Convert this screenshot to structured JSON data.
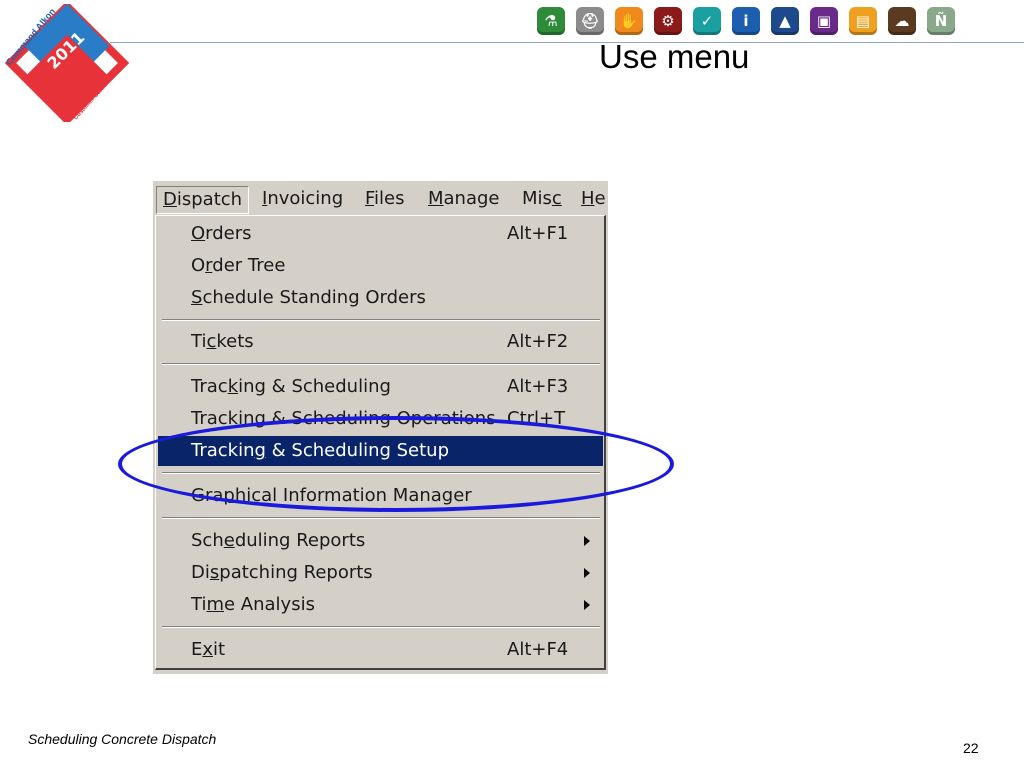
{
  "logo": {
    "arc_top": "Command Alkon",
    "year": "2011",
    "arc_bottom": "Customer Conference"
  },
  "toolbar_icons": [
    {
      "name": "flask-icon",
      "color": "#2e8b3a",
      "glyph": "⚗"
    },
    {
      "name": "hardhat-icon",
      "color": "#8c8c8c",
      "glyph": "⛑"
    },
    {
      "name": "hand-icon",
      "color": "#f08a1c",
      "glyph": "✋"
    },
    {
      "name": "gears-icon",
      "color": "#8b1a1a",
      "glyph": "⚙"
    },
    {
      "name": "checkmark-icon",
      "color": "#1aa0a0",
      "glyph": "✓"
    },
    {
      "name": "info-icon",
      "color": "#1c5fb0",
      "glyph": "i"
    },
    {
      "name": "person-desk-icon",
      "color": "#1c4a8c",
      "glyph": "▲"
    },
    {
      "name": "panel-icon",
      "color": "#6a2a8a",
      "glyph": "▣"
    },
    {
      "name": "document-icon",
      "color": "#f0a020",
      "glyph": "▤"
    },
    {
      "name": "cloud-icon",
      "color": "#5a3a20",
      "glyph": "☁"
    },
    {
      "name": "n-icon",
      "color": "#8aa88a",
      "glyph": "Ñ"
    }
  ],
  "slide": {
    "title": "Use menu",
    "footer": "Scheduling Concrete Dispatch",
    "page_number": "22"
  },
  "menubar": [
    {
      "pre": "",
      "u": "D",
      "post": "ispatch"
    },
    {
      "pre": "",
      "u": "I",
      "post": "nvoicing"
    },
    {
      "pre": "",
      "u": "F",
      "post": "iles"
    },
    {
      "pre": "",
      "u": "M",
      "post": "anage"
    },
    {
      "pre": "Mis",
      "u": "c",
      "post": ""
    },
    {
      "pre": "",
      "u": "H",
      "post": "e"
    }
  ],
  "menu_items": [
    {
      "pre": "",
      "u": "O",
      "post": "rders",
      "shortcut": "Alt+F1"
    },
    {
      "pre": "O",
      "u": "r",
      "post": "der Tree",
      "shortcut": ""
    },
    {
      "pre": "",
      "u": "S",
      "post": "chedule Standing Orders",
      "shortcut": ""
    },
    {
      "pre": "Ti",
      "u": "c",
      "post": "kets",
      "shortcut": "Alt+F2"
    },
    {
      "pre": "Trac",
      "u": "k",
      "post": "ing & Scheduling",
      "shortcut": "Alt+F3"
    },
    {
      "pre": "Tracki",
      "u": "n",
      "post": "g & Scheduling Operations",
      "shortcut": "Ctrl+T"
    },
    {
      "pre": "Trackin",
      "u": "g",
      "post": " & Scheduling Setup",
      "shortcut": ""
    },
    {
      "pre": "Gra",
      "u": "p",
      "post": "hical Information Manager",
      "shortcut": ""
    },
    {
      "pre": "Sch",
      "u": "e",
      "post": "duling Reports",
      "shortcut": ""
    },
    {
      "pre": "Di",
      "u": "s",
      "post": "patching Reports",
      "shortcut": ""
    },
    {
      "pre": "Ti",
      "u": "m",
      "post": "e Analysis",
      "shortcut": ""
    },
    {
      "pre": "E",
      "u": "x",
      "post": "it",
      "shortcut": "Alt+F4"
    }
  ]
}
